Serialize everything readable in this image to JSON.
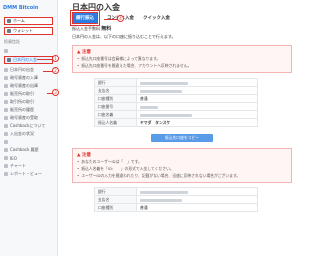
{
  "brand": "DMM Bitcoin",
  "sidebar": {
    "items": [
      {
        "label": "ホーム",
        "boxed": true
      },
      {
        "label": "ウォレット",
        "boxed": true
      },
      {
        "label": "",
        "boxed": false
      },
      {
        "label": "日本円の入金",
        "boxed": true,
        "selected": true
      },
      {
        "label": "日本円の出金",
        "boxed": false
      },
      {
        "label": "暗号資産の入庫",
        "boxed": false
      },
      {
        "label": "暗号資産の出庫",
        "boxed": false
      },
      {
        "label": "販売所の取引",
        "boxed": false
      },
      {
        "label": "取引所の取引",
        "boxed": false
      },
      {
        "label": "販売所の履歴",
        "boxed": false
      },
      {
        "label": "暗号資産の受取",
        "boxed": false
      },
      {
        "label": "Cashbackについて",
        "boxed": false
      },
      {
        "label": "入出金の状況",
        "boxed": false
      },
      {
        "label": "",
        "boxed": false
      },
      {
        "label": "Cashback 履歴",
        "boxed": false
      },
      {
        "label": "IEO",
        "boxed": false
      },
      {
        "label": "チャート",
        "boxed": false
      },
      {
        "label": "レポート・ビュー",
        "boxed": false
      }
    ],
    "section_label": "投資信託"
  },
  "main": {
    "title": "日本円の入金",
    "tabs": [
      "銀行振込",
      "コンビニ入金",
      "クイック入金"
    ],
    "fee_label": "振込入金手数料",
    "fee_value": "無料",
    "desc": "日本円の入金は、以下の口座に振り込むことで行えます。",
    "warn1": {
      "title": "注意",
      "items": [
        "振込先口座番号は会員様によって異なります。",
        "振込先口座番号を間違えた場合、アカウントへ反映されません。"
      ]
    },
    "account": {
      "rows": [
        {
          "k": "銀行",
          "v": ""
        },
        {
          "k": "支店名",
          "v": ""
        },
        {
          "k": "口座種別",
          "v": "普通"
        },
        {
          "k": "口座番号",
          "v": ""
        },
        {
          "k": "口座名義",
          "v": ""
        },
        {
          "k": "振込人名義",
          "v": "ヤマダ　タンスケ"
        }
      ]
    },
    "copy_button": "振込先口座をコピー",
    "warn2": {
      "title": "注意",
      "items": [
        "あなたのユーザーIDは「　」です。",
        "振込人名義を「ID:　　」の形式で入金してください。",
        "ユーザーIDの入力を間違われたり、記載がない場合、迅速に反映されない場合がございます。"
      ]
    },
    "account2": {
      "rows": [
        {
          "k": "銀行",
          "v": ""
        },
        {
          "k": "支店名",
          "v": ""
        },
        {
          "k": "口座種別",
          "v": "普通"
        }
      ]
    }
  }
}
